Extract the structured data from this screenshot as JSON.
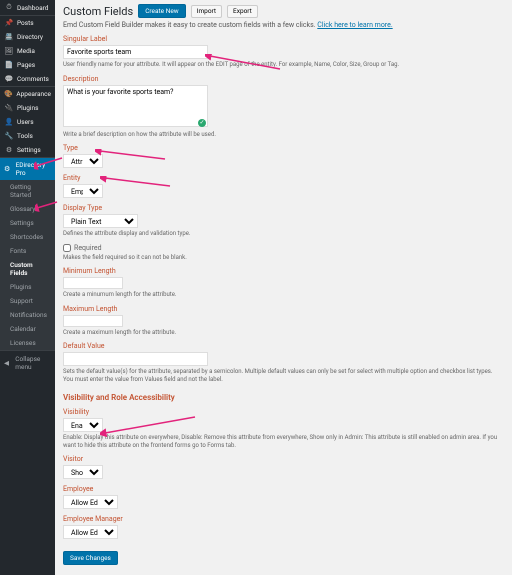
{
  "sidebar": {
    "items": [
      {
        "icon": "⏱",
        "label": "Dashboard"
      },
      {
        "icon": "📌",
        "label": "Posts"
      },
      {
        "icon": "📇",
        "label": "Directory"
      },
      {
        "icon": "🖼",
        "label": "Media"
      },
      {
        "icon": "📄",
        "label": "Pages"
      },
      {
        "icon": "💬",
        "label": "Comments"
      },
      {
        "icon": "🎨",
        "label": "Appearance"
      },
      {
        "icon": "🔌",
        "label": "Plugins"
      },
      {
        "icon": "👤",
        "label": "Users"
      },
      {
        "icon": "🔧",
        "label": "Tools"
      },
      {
        "icon": "⚙",
        "label": "Settings"
      }
    ],
    "plugin_header": {
      "icon": "⚙",
      "label": "EDirectory Pro"
    },
    "sub_items": [
      "Getting Started",
      "Glossary",
      "Settings",
      "Shortcodes",
      "Fonts",
      "Custom Fields",
      "Plugins",
      "Support",
      "Notifications",
      "Calendar",
      "Licenses"
    ],
    "collapse": "Collapse menu"
  },
  "header": {
    "title": "Custom Fields",
    "create": "Create New",
    "import": "Import",
    "export": "Export",
    "intro_a": "Emd Custom Field Builder makes it easy to create custom fields with a few clicks. ",
    "intro_link": "Click here to learn more."
  },
  "fields": {
    "singular_label": {
      "label": "Singular Label",
      "value": "Favorite sports team",
      "help": "User friendly name for your attribute. It will appear on the EDIT page of the entity. For example, Name, Color, Size, Group or Tag."
    },
    "description": {
      "label": "Description",
      "value": "What is your favorite sports team?",
      "help": "Write a brief description on how the attribute will be used."
    },
    "type": {
      "label": "Type",
      "value": "Attribute"
    },
    "entity": {
      "label": "Entity",
      "value": "Employees"
    },
    "display_type": {
      "label": "Display Type",
      "value": "Plain Text",
      "help": "Defines the attribute display and validation type."
    },
    "required": {
      "label": "Required",
      "help": "Makes the field required so it can not be blank."
    },
    "min_length": {
      "label": "Minimum Length",
      "help": "Create a minumum length for the attribute."
    },
    "max_length": {
      "label": "Maximum Length",
      "help": "Create a maximum length for the attribute."
    },
    "default_value": {
      "label": "Default Value",
      "help": "Sets the default value(s) for the attribute, separated by a semicolon. Multiple default values can only be set for select with multiple option and checkbox list types. You must enter the value from Values field and not the label."
    }
  },
  "visibility": {
    "section": "Visibility and Role Accessibility",
    "visibility": {
      "label": "Visibility",
      "value": "Enable",
      "help": "Enable: Display this attribute on everywhere, Disable: Remove this attribute from everywhere, Show only in Admin: This attribute is still enabled on admin area. If you want to hide this attribute on the frontend forms go to Forms tab."
    },
    "visitor": {
      "label": "Visitor",
      "value": "Show"
    },
    "employee": {
      "label": "Employee",
      "value": "Allow Edit"
    },
    "manager": {
      "label": "Employee Manager",
      "value": "Allow Edit"
    }
  },
  "save": "Save Changes"
}
